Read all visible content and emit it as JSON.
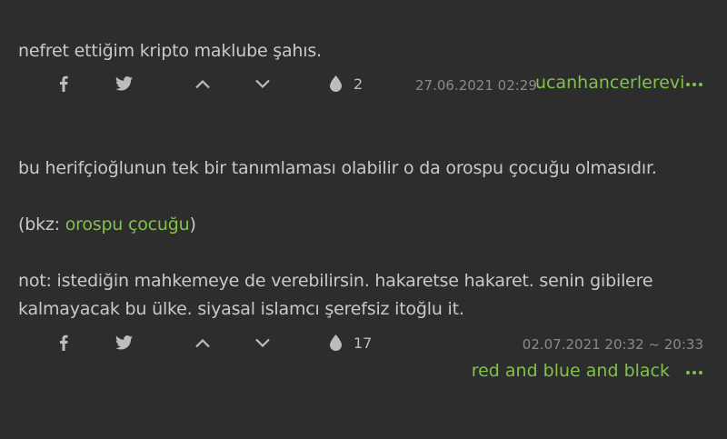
{
  "entries": [
    {
      "text": "nefret ettiğim kripto maklube şahıs.",
      "favorite_count": "2",
      "date": "27.06.2021 02:29",
      "author": "ucanhancerlerevi"
    },
    {
      "p1": "bu herifçioğlunun tek bir tanımlaması olabilir o da orospu çocuğu olmasıdır.",
      "bkz_prefix": "(bkz: ",
      "bkz_link": "orospu çocuğu",
      "bkz_suffix": ")",
      "p3_line1": "not: istediğin mahkemeye de verebilirsin. hakaretse hakaret. senin gibilere",
      "p3_line2": "kalmayacak bu ülke. siyasal islamcı şerefsiz itoğlu it.",
      "favorite_count": "17",
      "date": "02.07.2021 20:32 ~ 20:33",
      "author": "red and blue and black"
    }
  ],
  "icons": {
    "share_facebook": "facebook-icon",
    "share_twitter": "twitter-icon",
    "upvote": "chevron-up-icon",
    "downvote": "chevron-down-icon",
    "favorite": "drop-icon",
    "more": "more-icon"
  },
  "colors": {
    "background": "#2d2d2d",
    "text": "#c9c9c9",
    "accent": "#81c14b",
    "muted": "#8a8a8a"
  }
}
